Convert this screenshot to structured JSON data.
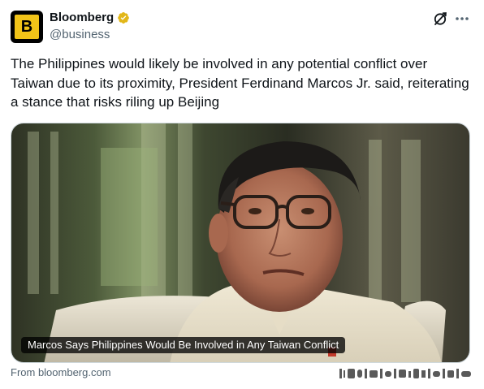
{
  "author": {
    "display_name": "Bloomberg",
    "handle": "@business",
    "avatar_letter": "B",
    "verified_badge_color": "#e2b719",
    "brand_color": "#f2c418"
  },
  "header_actions": {
    "grok_icon": "grok-icon",
    "more_icon": "more-icon"
  },
  "tweet": {
    "text": "The Philippines would likely be involved in any potential conflict over Taiwan due to its proximity, President Ferdinand Marcos Jr. said, reiterating a stance that risks riling up Beijing"
  },
  "link_card": {
    "caption": "Marcos Says Philippines Would Be Involved in Any Taiwan Conflict",
    "source": "From bloomberg.com",
    "image": "portrait of Ferdinand Marcos Jr. wearing glasses"
  },
  "colors": {
    "text_primary": "#0f1419",
    "text_secondary": "#536471",
    "border": "#cfd9de"
  }
}
